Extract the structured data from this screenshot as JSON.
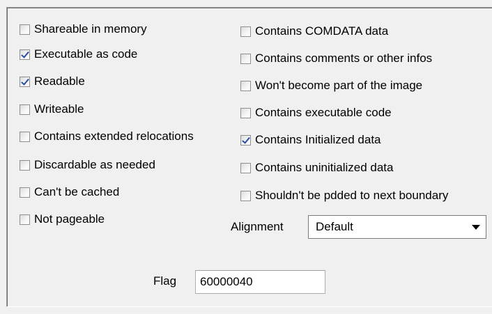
{
  "flags_left": [
    {
      "label": "Shareable in memory",
      "checked": false
    },
    {
      "label": "Executable as code",
      "checked": true
    },
    {
      "label": "Readable",
      "checked": true
    },
    {
      "label": "Writeable",
      "checked": false
    },
    {
      "label": "Contains extended relocations",
      "checked": false
    },
    {
      "label": "Discardable as needed",
      "checked": false
    },
    {
      "label": "Can't be cached",
      "checked": false
    },
    {
      "label": "Not pageable",
      "checked": false
    }
  ],
  "flags_right": [
    {
      "label": "Contains COMDATA data",
      "checked": false
    },
    {
      "label": "Contains comments or other infos",
      "checked": false
    },
    {
      "label": "Won't become part of the image",
      "checked": false
    },
    {
      "label": "Contains executable code",
      "checked": false
    },
    {
      "label": "Contains Initialized data",
      "checked": true
    },
    {
      "label": "Contains uninitialized data",
      "checked": false
    },
    {
      "label": "Shouldn't be pdded to next boundary",
      "checked": false
    }
  ],
  "alignment": {
    "label": "Alignment",
    "selected": "Default"
  },
  "flag": {
    "label": "Flag",
    "value": "60000040"
  }
}
